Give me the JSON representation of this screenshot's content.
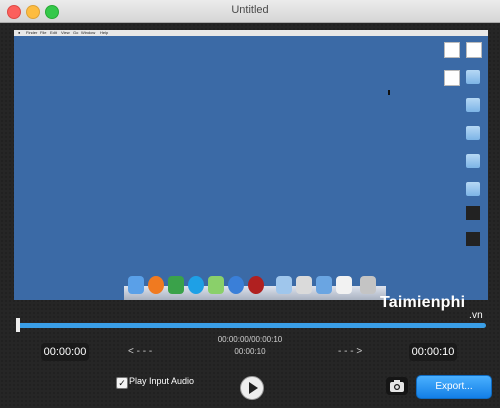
{
  "window": {
    "title": "Untitled"
  },
  "desktop_menu": [
    "Finder",
    "File",
    "Edit",
    "View",
    "Go",
    "Window",
    "Help"
  ],
  "desktop_items": [
    {
      "name": "doc-icon",
      "label": ""
    },
    {
      "name": "doc-icon",
      "label": ""
    },
    {
      "name": "folder-icon",
      "label": ""
    },
    {
      "name": "folder-icon",
      "label": ""
    },
    {
      "name": "folder-icon",
      "label": ""
    },
    {
      "name": "folder-icon",
      "label": ""
    },
    {
      "name": "folder-icon",
      "label": ""
    },
    {
      "name": "music-file-icon",
      "label": ""
    },
    {
      "name": "music-file-icon",
      "label": ""
    }
  ],
  "dock_icons": [
    "finder-icon",
    "firefox-icon",
    "app-cp-icon",
    "skype-icon",
    "app-icon",
    "safari-icon",
    "record-icon",
    "folder-icon",
    "photos-icon",
    "mail-icon",
    "app-icon",
    "trash-icon"
  ],
  "timeline": {
    "position_fraction": 0.0,
    "start_time": "00:00:00",
    "end_time": "00:00:10",
    "current_total": "00:00:00/00:00:10",
    "duration": "00:00:10",
    "left_arrow": "< - - -",
    "right_arrow": "- - - >"
  },
  "controls": {
    "play_input_audio_label": "Play Input Audio",
    "play_input_audio_checked": true,
    "export_label": "Export..."
  },
  "watermark": {
    "text": "Taimienphi",
    "suffix": ".vn"
  },
  "colors": {
    "accent": "#3a9ee6",
    "export": "#1a8cff",
    "desktop": "#3b6aa6"
  }
}
